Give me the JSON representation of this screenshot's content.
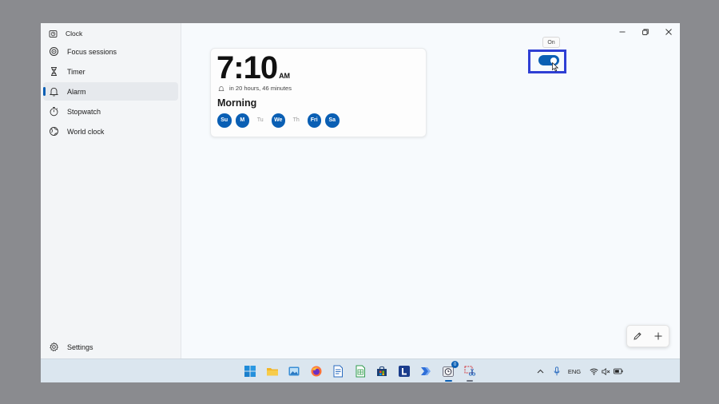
{
  "app": {
    "title": "Clock"
  },
  "sidebar": {
    "items": [
      {
        "label": "Focus sessions",
        "icon": "focus-icon"
      },
      {
        "label": "Timer",
        "icon": "hourglass-icon"
      },
      {
        "label": "Alarm",
        "icon": "bell-icon",
        "selected": true
      },
      {
        "label": "Stopwatch",
        "icon": "stopwatch-icon"
      },
      {
        "label": "World clock",
        "icon": "globe-icon"
      }
    ],
    "settings_label": "Settings"
  },
  "alarm": {
    "time": "7:10",
    "ampm": "AM",
    "remaining": "in 20 hours, 46 minutes",
    "name": "Morning",
    "enabled": true,
    "tooltip": "On",
    "days": [
      {
        "label": "Su",
        "active": true
      },
      {
        "label": "M",
        "active": true
      },
      {
        "label": "Tu",
        "active": false
      },
      {
        "label": "We",
        "active": true
      },
      {
        "label": "Th",
        "active": false
      },
      {
        "label": "Fri",
        "active": true
      },
      {
        "label": "Sa",
        "active": true
      }
    ]
  },
  "taskbar": {
    "language": "ENG",
    "clock_badge": "0",
    "apps": [
      "start-icon",
      "file-explorer-icon",
      "photos-icon",
      "firefox-icon",
      "writer-icon",
      "calc-icon",
      "store-icon",
      "l-app-icon",
      "power-automate-icon",
      "clock-app-icon",
      "snipping-tool-icon"
    ]
  },
  "colors": {
    "accent": "#0a5fb4",
    "highlight_frame": "#2f3fd4"
  }
}
